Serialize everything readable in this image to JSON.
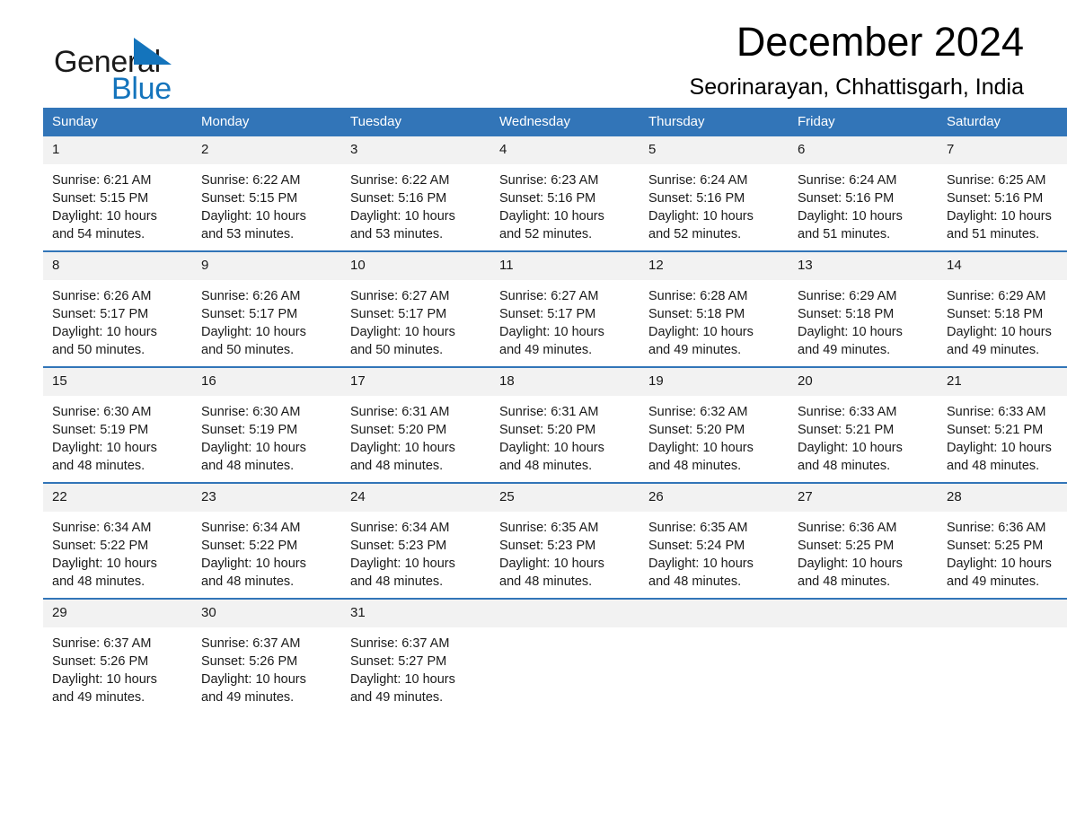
{
  "brand": {
    "name_part1": "General",
    "name_part2": "Blue",
    "flag_icon": "triangle-flag-icon",
    "accent_color": "#1474bc"
  },
  "header": {
    "month_title": "December 2024",
    "location": "Seorinarayan, Chhattisgarh, India"
  },
  "theme": {
    "header_blue": "#3275b8",
    "daynum_gray": "#f2f2f2",
    "text_black": "#1a1a1a"
  },
  "calendar": {
    "weekday_headers": [
      "Sunday",
      "Monday",
      "Tuesday",
      "Wednesday",
      "Thursday",
      "Friday",
      "Saturday"
    ],
    "weeks": [
      [
        {
          "day": "1",
          "sunrise": "Sunrise: 6:21 AM",
          "sunset": "Sunset: 5:15 PM",
          "daylight_line1": "Daylight: 10 hours",
          "daylight_line2": "and 54 minutes."
        },
        {
          "day": "2",
          "sunrise": "Sunrise: 6:22 AM",
          "sunset": "Sunset: 5:15 PM",
          "daylight_line1": "Daylight: 10 hours",
          "daylight_line2": "and 53 minutes."
        },
        {
          "day": "3",
          "sunrise": "Sunrise: 6:22 AM",
          "sunset": "Sunset: 5:16 PM",
          "daylight_line1": "Daylight: 10 hours",
          "daylight_line2": "and 53 minutes."
        },
        {
          "day": "4",
          "sunrise": "Sunrise: 6:23 AM",
          "sunset": "Sunset: 5:16 PM",
          "daylight_line1": "Daylight: 10 hours",
          "daylight_line2": "and 52 minutes."
        },
        {
          "day": "5",
          "sunrise": "Sunrise: 6:24 AM",
          "sunset": "Sunset: 5:16 PM",
          "daylight_line1": "Daylight: 10 hours",
          "daylight_line2": "and 52 minutes."
        },
        {
          "day": "6",
          "sunrise": "Sunrise: 6:24 AM",
          "sunset": "Sunset: 5:16 PM",
          "daylight_line1": "Daylight: 10 hours",
          "daylight_line2": "and 51 minutes."
        },
        {
          "day": "7",
          "sunrise": "Sunrise: 6:25 AM",
          "sunset": "Sunset: 5:16 PM",
          "daylight_line1": "Daylight: 10 hours",
          "daylight_line2": "and 51 minutes."
        }
      ],
      [
        {
          "day": "8",
          "sunrise": "Sunrise: 6:26 AM",
          "sunset": "Sunset: 5:17 PM",
          "daylight_line1": "Daylight: 10 hours",
          "daylight_line2": "and 50 minutes."
        },
        {
          "day": "9",
          "sunrise": "Sunrise: 6:26 AM",
          "sunset": "Sunset: 5:17 PM",
          "daylight_line1": "Daylight: 10 hours",
          "daylight_line2": "and 50 minutes."
        },
        {
          "day": "10",
          "sunrise": "Sunrise: 6:27 AM",
          "sunset": "Sunset: 5:17 PM",
          "daylight_line1": "Daylight: 10 hours",
          "daylight_line2": "and 50 minutes."
        },
        {
          "day": "11",
          "sunrise": "Sunrise: 6:27 AM",
          "sunset": "Sunset: 5:17 PM",
          "daylight_line1": "Daylight: 10 hours",
          "daylight_line2": "and 49 minutes."
        },
        {
          "day": "12",
          "sunrise": "Sunrise: 6:28 AM",
          "sunset": "Sunset: 5:18 PM",
          "daylight_line1": "Daylight: 10 hours",
          "daylight_line2": "and 49 minutes."
        },
        {
          "day": "13",
          "sunrise": "Sunrise: 6:29 AM",
          "sunset": "Sunset: 5:18 PM",
          "daylight_line1": "Daylight: 10 hours",
          "daylight_line2": "and 49 minutes."
        },
        {
          "day": "14",
          "sunrise": "Sunrise: 6:29 AM",
          "sunset": "Sunset: 5:18 PM",
          "daylight_line1": "Daylight: 10 hours",
          "daylight_line2": "and 49 minutes."
        }
      ],
      [
        {
          "day": "15",
          "sunrise": "Sunrise: 6:30 AM",
          "sunset": "Sunset: 5:19 PM",
          "daylight_line1": "Daylight: 10 hours",
          "daylight_line2": "and 48 minutes."
        },
        {
          "day": "16",
          "sunrise": "Sunrise: 6:30 AM",
          "sunset": "Sunset: 5:19 PM",
          "daylight_line1": "Daylight: 10 hours",
          "daylight_line2": "and 48 minutes."
        },
        {
          "day": "17",
          "sunrise": "Sunrise: 6:31 AM",
          "sunset": "Sunset: 5:20 PM",
          "daylight_line1": "Daylight: 10 hours",
          "daylight_line2": "and 48 minutes."
        },
        {
          "day": "18",
          "sunrise": "Sunrise: 6:31 AM",
          "sunset": "Sunset: 5:20 PM",
          "daylight_line1": "Daylight: 10 hours",
          "daylight_line2": "and 48 minutes."
        },
        {
          "day": "19",
          "sunrise": "Sunrise: 6:32 AM",
          "sunset": "Sunset: 5:20 PM",
          "daylight_line1": "Daylight: 10 hours",
          "daylight_line2": "and 48 minutes."
        },
        {
          "day": "20",
          "sunrise": "Sunrise: 6:33 AM",
          "sunset": "Sunset: 5:21 PM",
          "daylight_line1": "Daylight: 10 hours",
          "daylight_line2": "and 48 minutes."
        },
        {
          "day": "21",
          "sunrise": "Sunrise: 6:33 AM",
          "sunset": "Sunset: 5:21 PM",
          "daylight_line1": "Daylight: 10 hours",
          "daylight_line2": "and 48 minutes."
        }
      ],
      [
        {
          "day": "22",
          "sunrise": "Sunrise: 6:34 AM",
          "sunset": "Sunset: 5:22 PM",
          "daylight_line1": "Daylight: 10 hours",
          "daylight_line2": "and 48 minutes."
        },
        {
          "day": "23",
          "sunrise": "Sunrise: 6:34 AM",
          "sunset": "Sunset: 5:22 PM",
          "daylight_line1": "Daylight: 10 hours",
          "daylight_line2": "and 48 minutes."
        },
        {
          "day": "24",
          "sunrise": "Sunrise: 6:34 AM",
          "sunset": "Sunset: 5:23 PM",
          "daylight_line1": "Daylight: 10 hours",
          "daylight_line2": "and 48 minutes."
        },
        {
          "day": "25",
          "sunrise": "Sunrise: 6:35 AM",
          "sunset": "Sunset: 5:23 PM",
          "daylight_line1": "Daylight: 10 hours",
          "daylight_line2": "and 48 minutes."
        },
        {
          "day": "26",
          "sunrise": "Sunrise: 6:35 AM",
          "sunset": "Sunset: 5:24 PM",
          "daylight_line1": "Daylight: 10 hours",
          "daylight_line2": "and 48 minutes."
        },
        {
          "day": "27",
          "sunrise": "Sunrise: 6:36 AM",
          "sunset": "Sunset: 5:25 PM",
          "daylight_line1": "Daylight: 10 hours",
          "daylight_line2": "and 48 minutes."
        },
        {
          "day": "28",
          "sunrise": "Sunrise: 6:36 AM",
          "sunset": "Sunset: 5:25 PM",
          "daylight_line1": "Daylight: 10 hours",
          "daylight_line2": "and 49 minutes."
        }
      ],
      [
        {
          "day": "29",
          "sunrise": "Sunrise: 6:37 AM",
          "sunset": "Sunset: 5:26 PM",
          "daylight_line1": "Daylight: 10 hours",
          "daylight_line2": "and 49 minutes."
        },
        {
          "day": "30",
          "sunrise": "Sunrise: 6:37 AM",
          "sunset": "Sunset: 5:26 PM",
          "daylight_line1": "Daylight: 10 hours",
          "daylight_line2": "and 49 minutes."
        },
        {
          "day": "31",
          "sunrise": "Sunrise: 6:37 AM",
          "sunset": "Sunset: 5:27 PM",
          "daylight_line1": "Daylight: 10 hours",
          "daylight_line2": "and 49 minutes."
        },
        {
          "day": "",
          "sunrise": "",
          "sunset": "",
          "daylight_line1": "",
          "daylight_line2": ""
        },
        {
          "day": "",
          "sunrise": "",
          "sunset": "",
          "daylight_line1": "",
          "daylight_line2": ""
        },
        {
          "day": "",
          "sunrise": "",
          "sunset": "",
          "daylight_line1": "",
          "daylight_line2": ""
        },
        {
          "day": "",
          "sunrise": "",
          "sunset": "",
          "daylight_line1": "",
          "daylight_line2": ""
        }
      ]
    ]
  }
}
